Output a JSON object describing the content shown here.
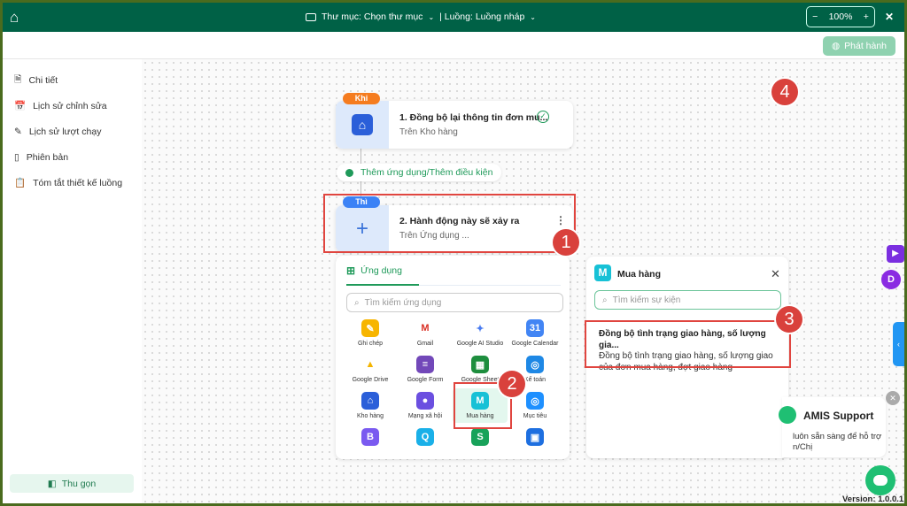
{
  "header": {
    "folder_label": "Thư mục: Chọn thư mục",
    "flow_label": "| Luồng: Luồng nháp",
    "zoom": "100%",
    "minus": "−",
    "plus": "+",
    "close": "✕"
  },
  "toolbar": {
    "publish_label": "Phát hành"
  },
  "sidebar": {
    "items": [
      {
        "label": "Chi tiết",
        "icon": "document-icon"
      },
      {
        "label": "Lịch sử chỉnh sửa",
        "icon": "calendar-clock-icon"
      },
      {
        "label": "Lịch sử lượt chạy",
        "icon": "run-history-icon"
      },
      {
        "label": "Phiên bản",
        "icon": "versions-icon"
      },
      {
        "label": "Tóm tắt thiết kế luồng",
        "icon": "clipboard-icon"
      }
    ],
    "collapse_label": "Thu gọn"
  },
  "trigger": {
    "tag": "Khi",
    "title": "1.  Đồng bộ lại thông tin đơn mu...",
    "subtitle": "Trên Kho hàng"
  },
  "add_step": {
    "label": "Thêm ứng dụng/Thêm điều kiện"
  },
  "action": {
    "tag": "Thì",
    "title": "2.  Hành động này sẽ xảy ra",
    "subtitle": "Trên Ứng dụng ..."
  },
  "apps_panel": {
    "tab": "Ứng dụng",
    "search_placeholder": "Tìm kiếm ứng dụng",
    "apps": [
      {
        "label": "Ghi chép",
        "color": "#f7b500"
      },
      {
        "label": "Gmail",
        "color": "#ffffff"
      },
      {
        "label": "Google AI Studio",
        "color": "#ffffff"
      },
      {
        "label": "Google Calendar",
        "color": "#4285f4"
      },
      {
        "label": "Google Drive",
        "color": "#ffffff"
      },
      {
        "label": "Google Form",
        "color": "#7248b9"
      },
      {
        "label": "Google Sheet",
        "color": "#1e8e3e"
      },
      {
        "label": "Kế toán",
        "color": "#1e88e5"
      },
      {
        "label": "Kho hàng",
        "color": "#2b5fd9"
      },
      {
        "label": "Mạng xã hội",
        "color": "#6b4fe0"
      },
      {
        "label": "Mua hàng",
        "color": "#17c1d6"
      },
      {
        "label": "Mục tiêu",
        "color": "#1e90ff"
      },
      {
        "label": "",
        "color": "#7a5af0"
      },
      {
        "label": "",
        "color": "#1ab0e8"
      },
      {
        "label": "",
        "color": "#18a25a"
      },
      {
        "label": "",
        "color": "#1e6fe0"
      }
    ]
  },
  "events_panel": {
    "title": "Mua hàng",
    "search_placeholder": "Tìm kiếm sự kiện",
    "events": [
      {
        "title": "Đồng bộ tình trạng giao hàng, số lượng gia...",
        "description": "Đồng bộ tình trạng giao hàng, số lượng giao của đơn mua hàng, đợt giao hàng"
      }
    ]
  },
  "support": {
    "title": "AMIS Support",
    "text_line1": "luôn sẵn sàng để hỗ trợ",
    "text_line2": "n/Chị"
  },
  "right_avatar": "D",
  "version": "Version: 1.0.0.1",
  "badges": [
    "1",
    "2",
    "3",
    "4"
  ],
  "colors": {
    "header": "#006146",
    "accent": "#1f9a5a",
    "annotation": "#e0453f",
    "publish": "#8fd2b0"
  }
}
